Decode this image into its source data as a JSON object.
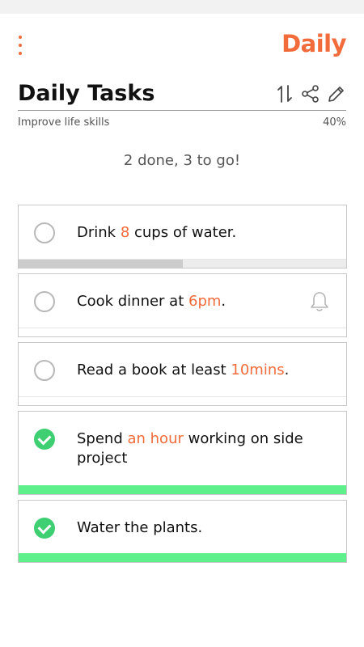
{
  "header": {
    "menu_icon": "vertical-dots-icon",
    "logo_text": "Daily",
    "title": "Daily Tasks",
    "subtitle": "Improve life skills",
    "percent": "40%",
    "icons": [
      "sort-icon",
      "share-icon",
      "edit-pencil-icon"
    ]
  },
  "summary": "2 done, 3 to go!",
  "tasks": [
    {
      "pre": "Drink ",
      "hl": "8",
      "post": " cups of water.",
      "done": false,
      "progress": 0.5,
      "has_bell": false
    },
    {
      "pre": "Cook dinner at ",
      "hl": "6pm",
      "post": ".",
      "done": false,
      "progress": null,
      "has_bell": true
    },
    {
      "pre": "Read a book at least ",
      "hl": "10mins",
      "post": ".",
      "done": false,
      "progress": null,
      "has_bell": false
    },
    {
      "pre": "Spend ",
      "hl": "an hour",
      "post": " working on side project",
      "done": true,
      "progress": 1,
      "has_bell": false
    },
    {
      "pre": "Water the plants.",
      "hl": "",
      "post": "",
      "done": true,
      "progress": 1,
      "has_bell": false
    }
  ],
  "colors": {
    "accent": "#f26b3a",
    "done_green": "#3ecf72",
    "bar_green": "#5ef08b",
    "progress_gray": "#cccccc"
  }
}
